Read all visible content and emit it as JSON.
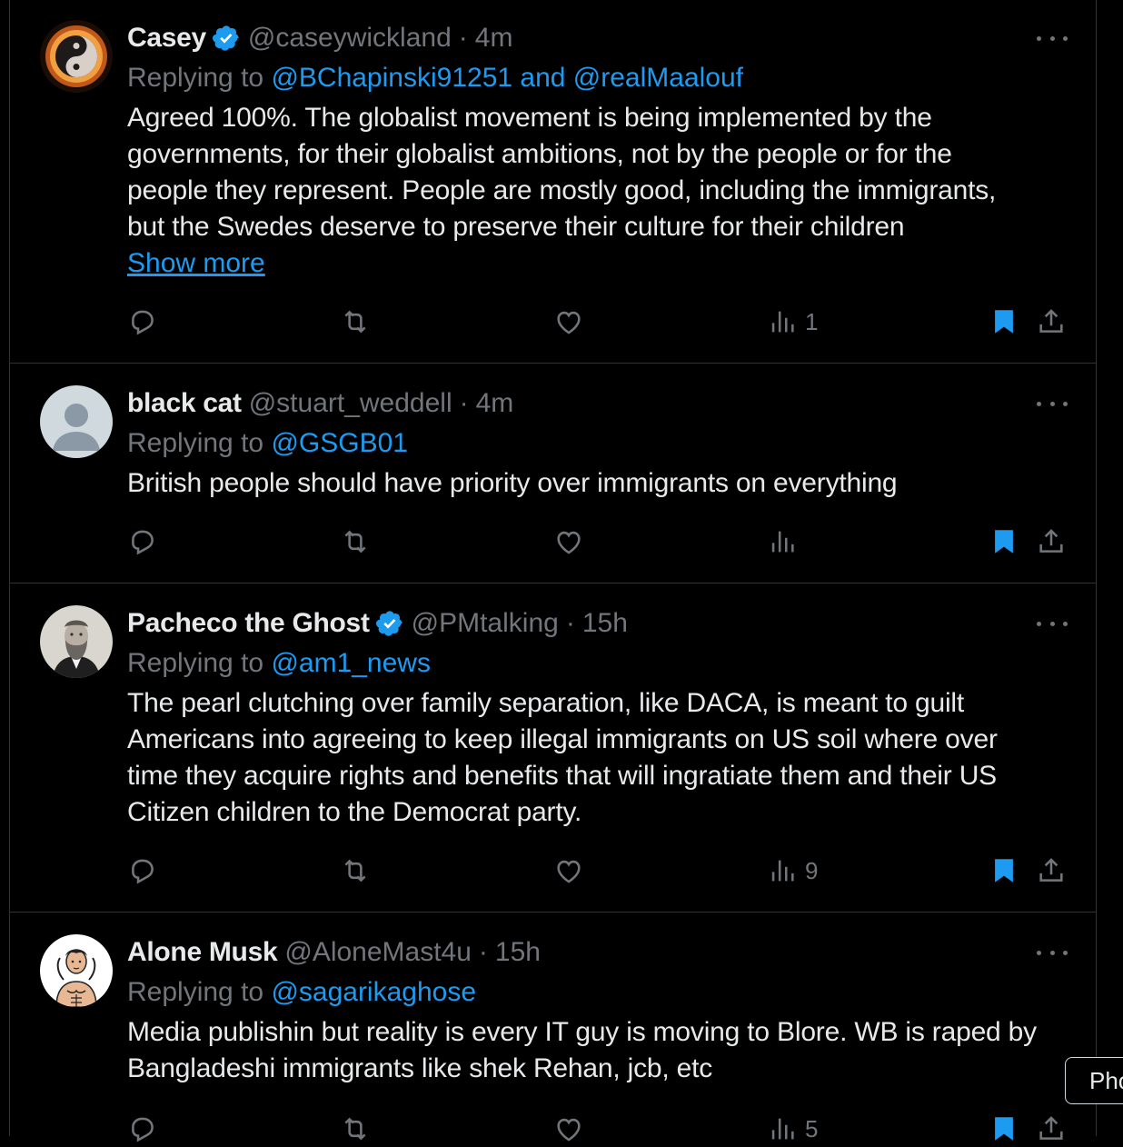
{
  "colors": {
    "background": "#000000",
    "text": "#e7e9ea",
    "muted": "#71767b",
    "link": "#1d9bf0",
    "bookmark_active": "#1d9bf0",
    "border": "#2f3336"
  },
  "tweets": [
    {
      "name": "Casey",
      "verified": true,
      "handle": "@caseywickland",
      "time": "4m",
      "replying_prefix": "Replying to ",
      "replying_to": "@BChapinski91251 and @realMaalouf",
      "text": "Agreed 100%.  The globalist movement is being implemented by the\ngovernments, for their globalist ambitions, not by the people or for the\npeople they represent.  People are mostly good, including the immigrants,\nbut the Swedes deserve to preserve their culture for their children",
      "show_more": "Show more",
      "views": "1",
      "bookmarked": true,
      "avatar_icon": "yin-yang-fire-avatar"
    },
    {
      "name": "black cat",
      "verified": false,
      "handle": "@stuart_weddell",
      "time": "4m",
      "replying_prefix": "Replying to ",
      "replying_to": "@GSGB01",
      "text": "British people should have priority over immigrants on everything",
      "views": "",
      "bookmarked": true,
      "avatar_icon": "default-user-avatar"
    },
    {
      "name": "Pacheco the Ghost",
      "verified": true,
      "handle": "@PMtalking",
      "time": "15h",
      "replying_prefix": "Replying to ",
      "replying_to": "@am1_news",
      "text": "The pearl clutching over family separation, like DACA, is meant to guilt\nAmericans into agreeing to keep  illegal immigrants on US soil where over\ntime they acquire rights and benefits that will ingratiate them and their US\nCitizen children to the Democrat party.",
      "views": "9",
      "bookmarked": true,
      "avatar_icon": "bearded-man-portrait-avatar"
    },
    {
      "name": "Alone Musk",
      "verified": false,
      "handle": "@AloneMast4u",
      "time": "15h",
      "replying_prefix": "Replying to ",
      "replying_to": "@sagarikaghose",
      "text": "Media publishin but reality is every IT guy is moving to Blore. WB is raped by\nBangladeshi immigrants like shek Rehan, jcb, etc",
      "views": "5",
      "bookmarked": true,
      "avatar_icon": "cartoon-muscle-man-avatar"
    }
  ],
  "separator": "·",
  "tooltip": {
    "text": "Pho"
  }
}
